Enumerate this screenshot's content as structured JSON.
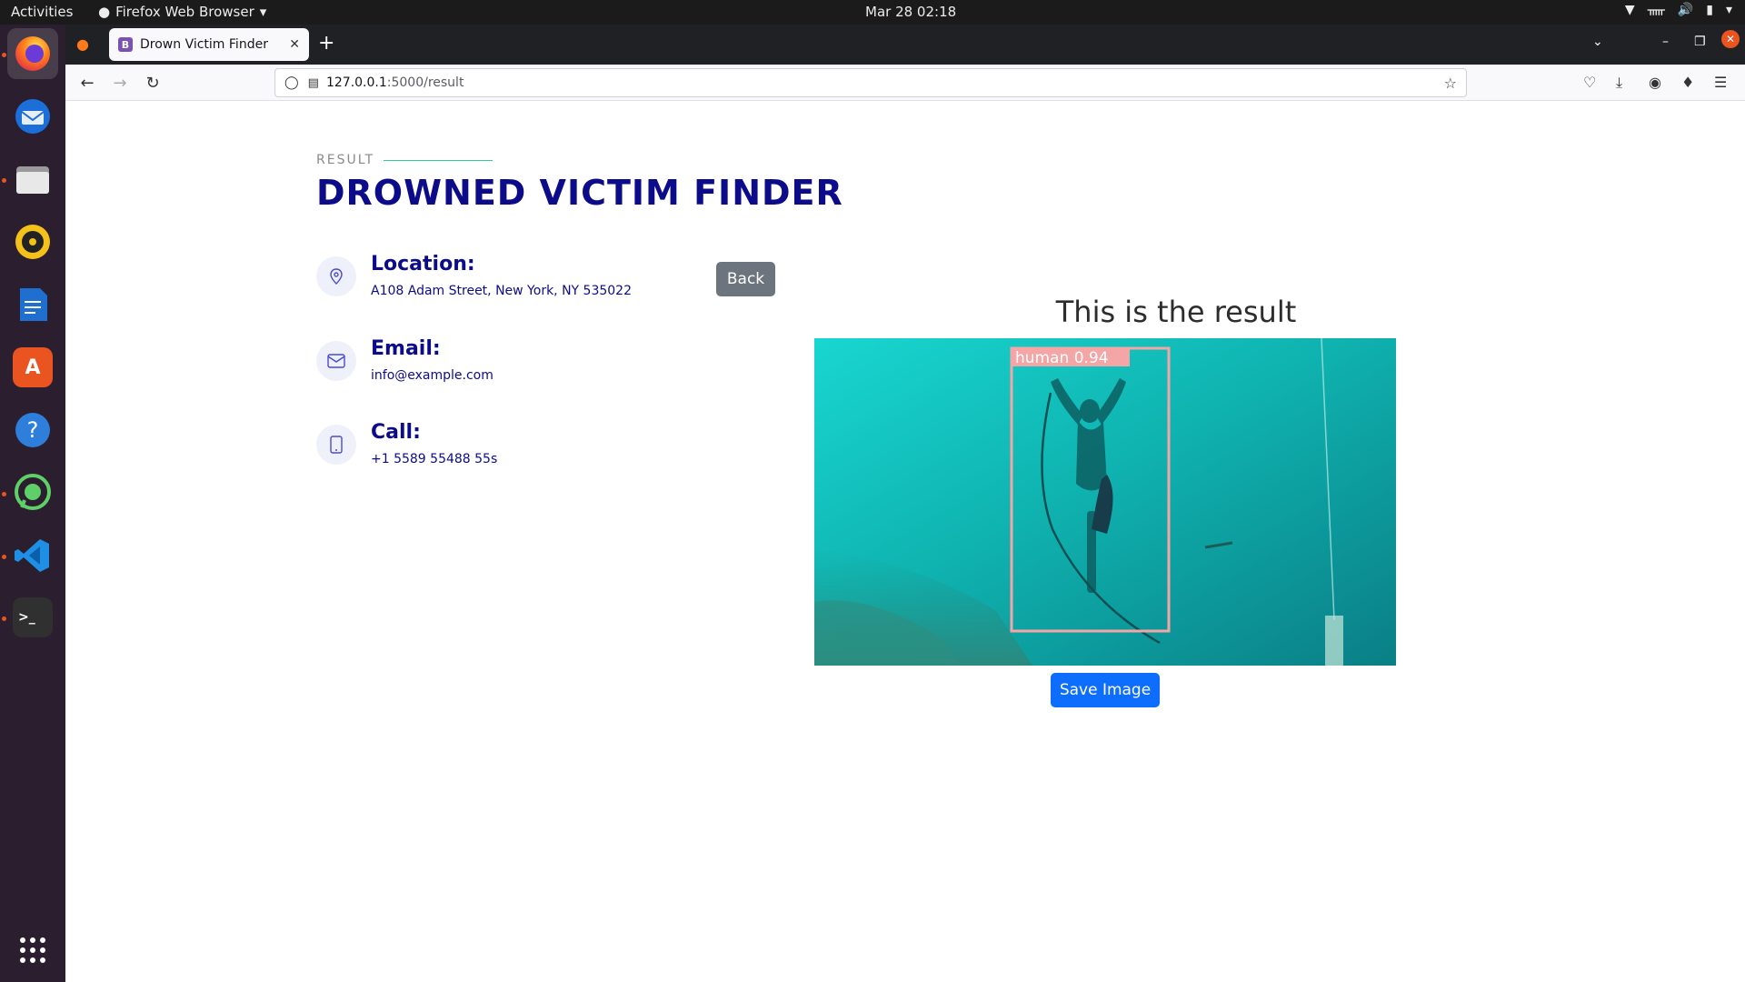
{
  "topbar": {
    "activities": "Activities",
    "app_menu": "Firefox Web Browser",
    "clock": "Mar 28  02:18"
  },
  "dock": {
    "items": [
      "firefox",
      "thunderbird",
      "files",
      "rhythmbox",
      "libreoffice-writer",
      "app-center",
      "help",
      "whatsapp",
      "vscode",
      "terminal"
    ],
    "show_apps_icon": "grid-icon"
  },
  "browser": {
    "tab_title": "Drown Victim Finder",
    "url_host": "127.0.0.1",
    "url_path": ":5000/result"
  },
  "page": {
    "section_label": "RESULT",
    "title": "DROWNED VICTIM FINDER",
    "location": {
      "label": "Location:",
      "value": "A108 Adam Street, New York, NY 535022"
    },
    "email": {
      "label": "Email:",
      "value": "info@example.com"
    },
    "call": {
      "label": "Call:",
      "value": "+1 5589 55488 55s"
    },
    "back_button": "Back",
    "result_heading": "This is the result",
    "detection_label": "human  0.94",
    "save_button": "Save Image"
  },
  "colors": {
    "title": "#0c0c8a",
    "back_button": "#6c757d",
    "save_button": "#0d6efd",
    "accent_line": "#2ecc9a",
    "detection_box": "#f4a6a6"
  }
}
